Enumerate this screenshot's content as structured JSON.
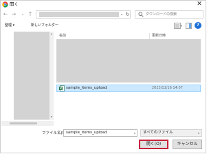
{
  "window": {
    "title": "開く",
    "close_glyph": "✕"
  },
  "navigation": {
    "back_glyph": "←",
    "forward_glyph": "→",
    "recent_glyph": "⌄",
    "up_glyph": "↑",
    "address_chevron": "⌄",
    "refresh_glyph": "↻"
  },
  "search": {
    "placeholder": "ダウンロードの検索"
  },
  "toolbar": {
    "organize_label": "整理 ▾",
    "new_folder_label": "新しいフォルダー",
    "view_chevron": "▾",
    "help_glyph": "?"
  },
  "file_list": {
    "columns": {
      "name": "名前",
      "date": "更新日時"
    },
    "selected_file": {
      "name": "sample_items_upload",
      "date": "2023/11/16 14:07"
    }
  },
  "footer": {
    "filename_label": "ファイル名(N):",
    "filename_value": "sample_items_upload",
    "input_chevron": "▾",
    "filetype_value": "すべてのファイル",
    "filetype_chevron": "▾",
    "open_label": "開く(O)",
    "cancel_label": "キャンセル"
  },
  "colors": {
    "accent": "#1c6fd6",
    "selection": "#cce8ff",
    "open_highlight": "#c7233a",
    "redacted": "#d3d3d3"
  },
  "icons": {
    "app": "chrome-icon",
    "search": "search-icon",
    "file": "excel-file-icon",
    "view": "view-options-icon",
    "panel": "preview-pane-icon",
    "help": "help-icon"
  }
}
